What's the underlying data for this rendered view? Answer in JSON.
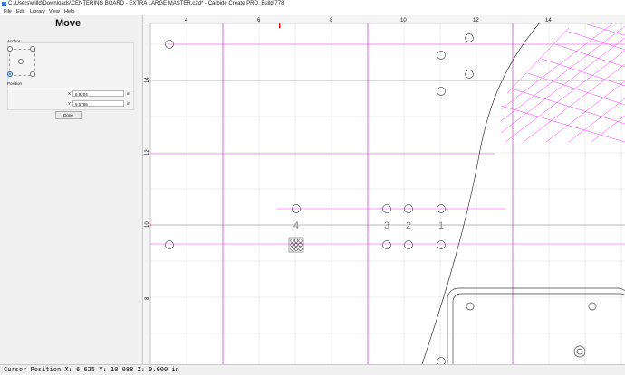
{
  "titlebar": {
    "title": "C:\\Users\\willd\\Downloads\\CENTERING BOARD - EXTRA LARGE MASTER.c2d* - Carbide Create PRO, Build 778"
  },
  "menu": [
    "File",
    "Edit",
    "Library",
    "View",
    "Help"
  ],
  "panel": {
    "title": "Move",
    "anchor_label": "Anchor",
    "position_label": "Position",
    "x_label": "X",
    "x_value": "6.9204",
    "y_label": "Y",
    "y_value": "9.5786",
    "unit": "in",
    "done_label": "Done",
    "selected_anchor": "bottom-left"
  },
  "ruler": {
    "top_labels": [
      "4",
      "6",
      "8",
      "10",
      "12",
      "14"
    ],
    "left_labels": [
      "14",
      "12",
      "10",
      "8"
    ]
  },
  "markers": [
    "4",
    "3",
    "2",
    "1"
  ],
  "status": {
    "text": "Cursor Position X: 6.625 Y: 10.088 Z: 0.000 in"
  },
  "colors": {
    "guide": "#ff33ff",
    "grid": "#dcdcdc",
    "cursor_marker": "#ff0000",
    "selected_radio": "#1a5ab8"
  }
}
